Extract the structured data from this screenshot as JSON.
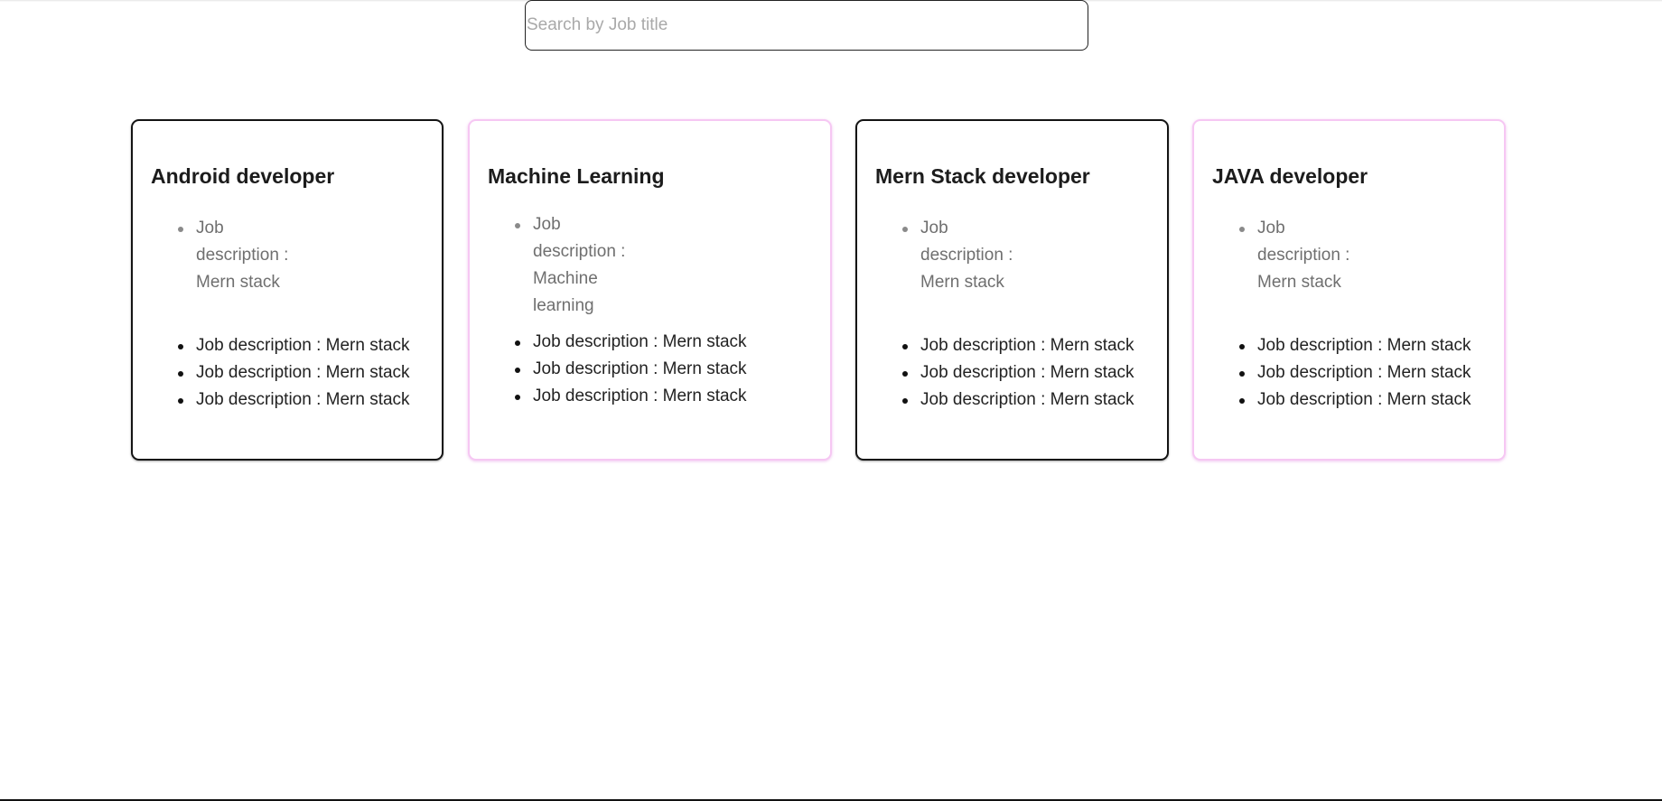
{
  "search": {
    "placeholder": "Search by Job title",
    "value": ""
  },
  "jobs": [
    {
      "title": "Android developer",
      "descriptions": [
        "Job description : Mern stack",
        "Job description : Mern stack",
        "Job description : Mern stack",
        "Job description : Mern stack"
      ]
    },
    {
      "title": "Machine Learning",
      "descriptions": [
        "Job description : Machine learning",
        "Job description : Mern stack",
        "Job description : Mern stack",
        "Job description : Mern stack"
      ]
    },
    {
      "title": "Mern Stack developer",
      "descriptions": [
        "Job description : Mern stack",
        "Job description : Mern stack",
        "Job description : Mern stack",
        "Job description : Mern stack"
      ]
    },
    {
      "title": "JAVA developer",
      "descriptions": [
        "Job description : Mern stack",
        "Job description : Mern stack",
        "Job description : Mern stack",
        "Job description : Mern stack"
      ]
    }
  ],
  "colors": {
    "card_border_dark": "#141414",
    "card_border_pink": "#f6c7f3",
    "first_item_text": "#6f6f6f",
    "item_text": "#222222"
  }
}
